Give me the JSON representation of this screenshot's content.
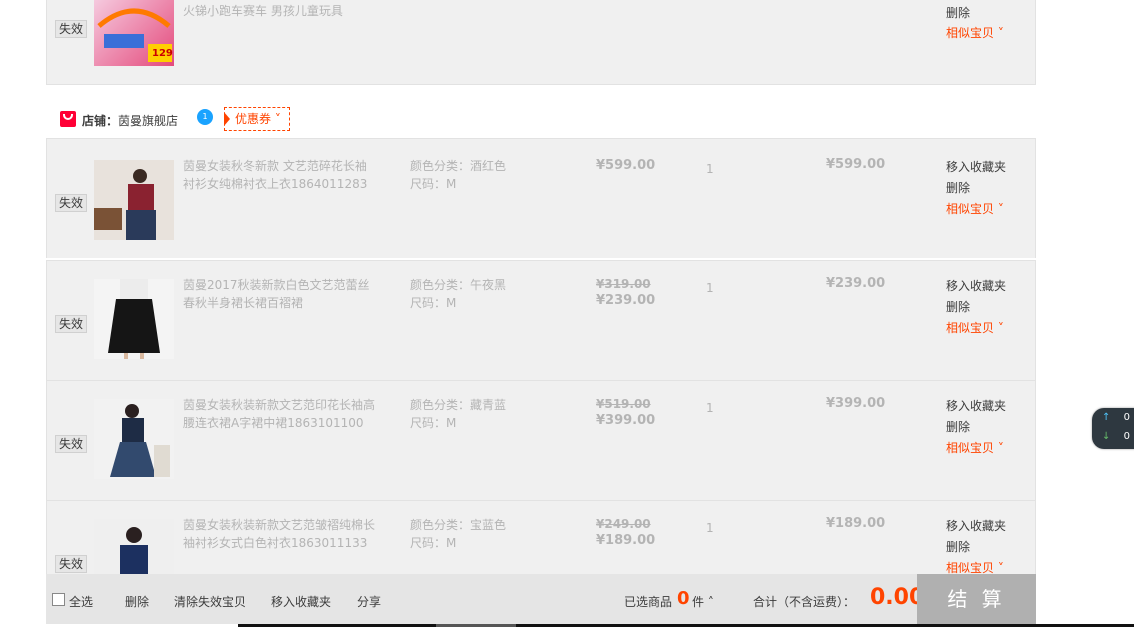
{
  "prev_item": {
    "status": "失效",
    "title": "火锑小跑车赛车 男孩儿童玩具",
    "ops": [
      "删除",
      "相似宝贝 ˅"
    ],
    "image_badge": "129"
  },
  "store": {
    "label": "店铺：",
    "name": "茵曼旗舰店",
    "chat_badge": "1",
    "coupon": "优惠券 ˅"
  },
  "items": [
    {
      "status": "失效",
      "title": "茵曼女装秋冬新款 文艺范碎花长袖衬衫女纯棉衬衣上衣1864011283",
      "color": "颜色分类：酒红色",
      "size": "尺码：M",
      "old_price": "",
      "price": "¥599.00",
      "qty": "1",
      "sum": "¥599.00",
      "ops": [
        "移入收藏夹",
        "删除",
        "相似宝贝 ˅"
      ],
      "thumb_color": "#8a2230",
      "thumb_bottom": "#2a3a5a"
    },
    {
      "status": "失效",
      "title": "茵曼2017秋装新款白色文艺范蕾丝春秋半身裙长裙百褶裙",
      "color": "颜色分类：午夜黑",
      "size": "尺码：M",
      "old_price": "¥319.00",
      "price": "¥239.00",
      "qty": "1",
      "sum": "¥239.00",
      "ops": [
        "移入收藏夹",
        "删除",
        "相似宝贝 ˅"
      ],
      "thumb_color": "#f2f2f2",
      "thumb_bottom": "#151515"
    },
    {
      "status": "失效",
      "title": "茵曼女装秋装新款文艺范印花长袖高腰连衣裙A字裙中裙1863101100",
      "color": "颜色分类：藏青蓝",
      "size": "尺码：M",
      "old_price": "¥519.00",
      "price": "¥399.00",
      "qty": "1",
      "sum": "¥399.00",
      "ops": [
        "移入收藏夹",
        "删除",
        "相似宝贝 ˅"
      ],
      "thumb_color": "#1e2c45",
      "thumb_bottom": "#324a6e"
    },
    {
      "status": "失效",
      "title": "茵曼女装秋装新款文艺范皱褶纯棉长袖衬衫女式白色衬衣1863011133",
      "color": "颜色分类：宝蓝色",
      "size": "尺码：M",
      "old_price": "¥249.00",
      "price": "¥189.00",
      "qty": "1",
      "sum": "¥189.00",
      "ops": [
        "移入收藏夹",
        "删除",
        "相似宝贝 ˅"
      ],
      "thumb_color": "#1c3060",
      "thumb_bottom": "#1c3060"
    }
  ],
  "footer": {
    "select_all": "全选",
    "delete": "删除",
    "clear_invalid": "清除失效宝贝",
    "move_fav": "移入收藏夹",
    "share": "分享",
    "selected_label": "已选商品",
    "selected_count": "0",
    "unit": "件 ˄",
    "total_label": "合计（不含运费）：",
    "total": "0.00",
    "checkout": "结 算"
  },
  "float_widget": {
    "up": "0",
    "down": "0"
  },
  "colors": {
    "accent": "#ff4400",
    "row_bg": "#f0f0f0",
    "muted_text": "#b4b4b4"
  }
}
